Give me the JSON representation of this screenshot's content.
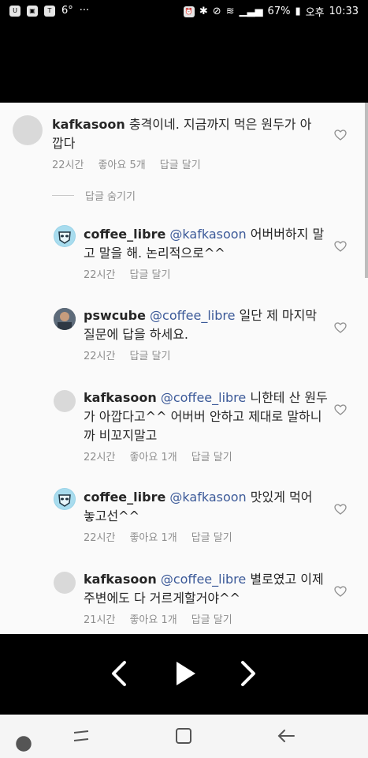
{
  "status": {
    "weather": "6°",
    "more": "···",
    "battery": "67%",
    "ampm": "오후",
    "time": "10:33"
  },
  "comments": [
    {
      "user": "kafkasoon",
      "mention": "",
      "text": "충격이네. 지금까지 먹은 원두가 아깝다",
      "time": "22시간",
      "likes": "좋아요 5개",
      "reply": "답글 달기"
    },
    {
      "user": "coffee_libre",
      "mention": "@kafkasoon",
      "text": "어버버하지 말고 말을 해. 논리적으로^^",
      "time": "22시간",
      "likes": "",
      "reply": "답글 달기"
    },
    {
      "user": "pswcube",
      "mention": "@coffee_libre",
      "text": "일단 제 마지막 질문에 답을 하세요.",
      "time": "22시간",
      "likes": "",
      "reply": "답글 달기"
    },
    {
      "user": "kafkasoon",
      "mention": "@coffee_libre",
      "text": "니한테 산 원두가 아깝다고^^ 어버버 안하고 제대로 말하니까 비꼬지말고",
      "time": "22시간",
      "likes": "좋아요 1개",
      "reply": "답글 달기"
    },
    {
      "user": "coffee_libre",
      "mention": "@kafkasoon",
      "text": "맛있게 먹어 놓고선^^",
      "time": "22시간",
      "likes": "좋아요 1개",
      "reply": "답글 달기"
    },
    {
      "user": "kafkasoon",
      "mention": "@coffee_libre",
      "text": "별로였고 이제 주변에도 다 거르게할거야^^",
      "time": "21시간",
      "likes": "좋아요 1개",
      "reply": "답글 달기"
    }
  ],
  "hide_replies": "답글 숨기기",
  "icons": {
    "like": "heart-icon",
    "prev": "chevron-left-icon",
    "play": "play-icon",
    "next": "chevron-right-icon",
    "recent": "recent-apps-icon",
    "home": "home-icon",
    "back": "back-icon"
  }
}
